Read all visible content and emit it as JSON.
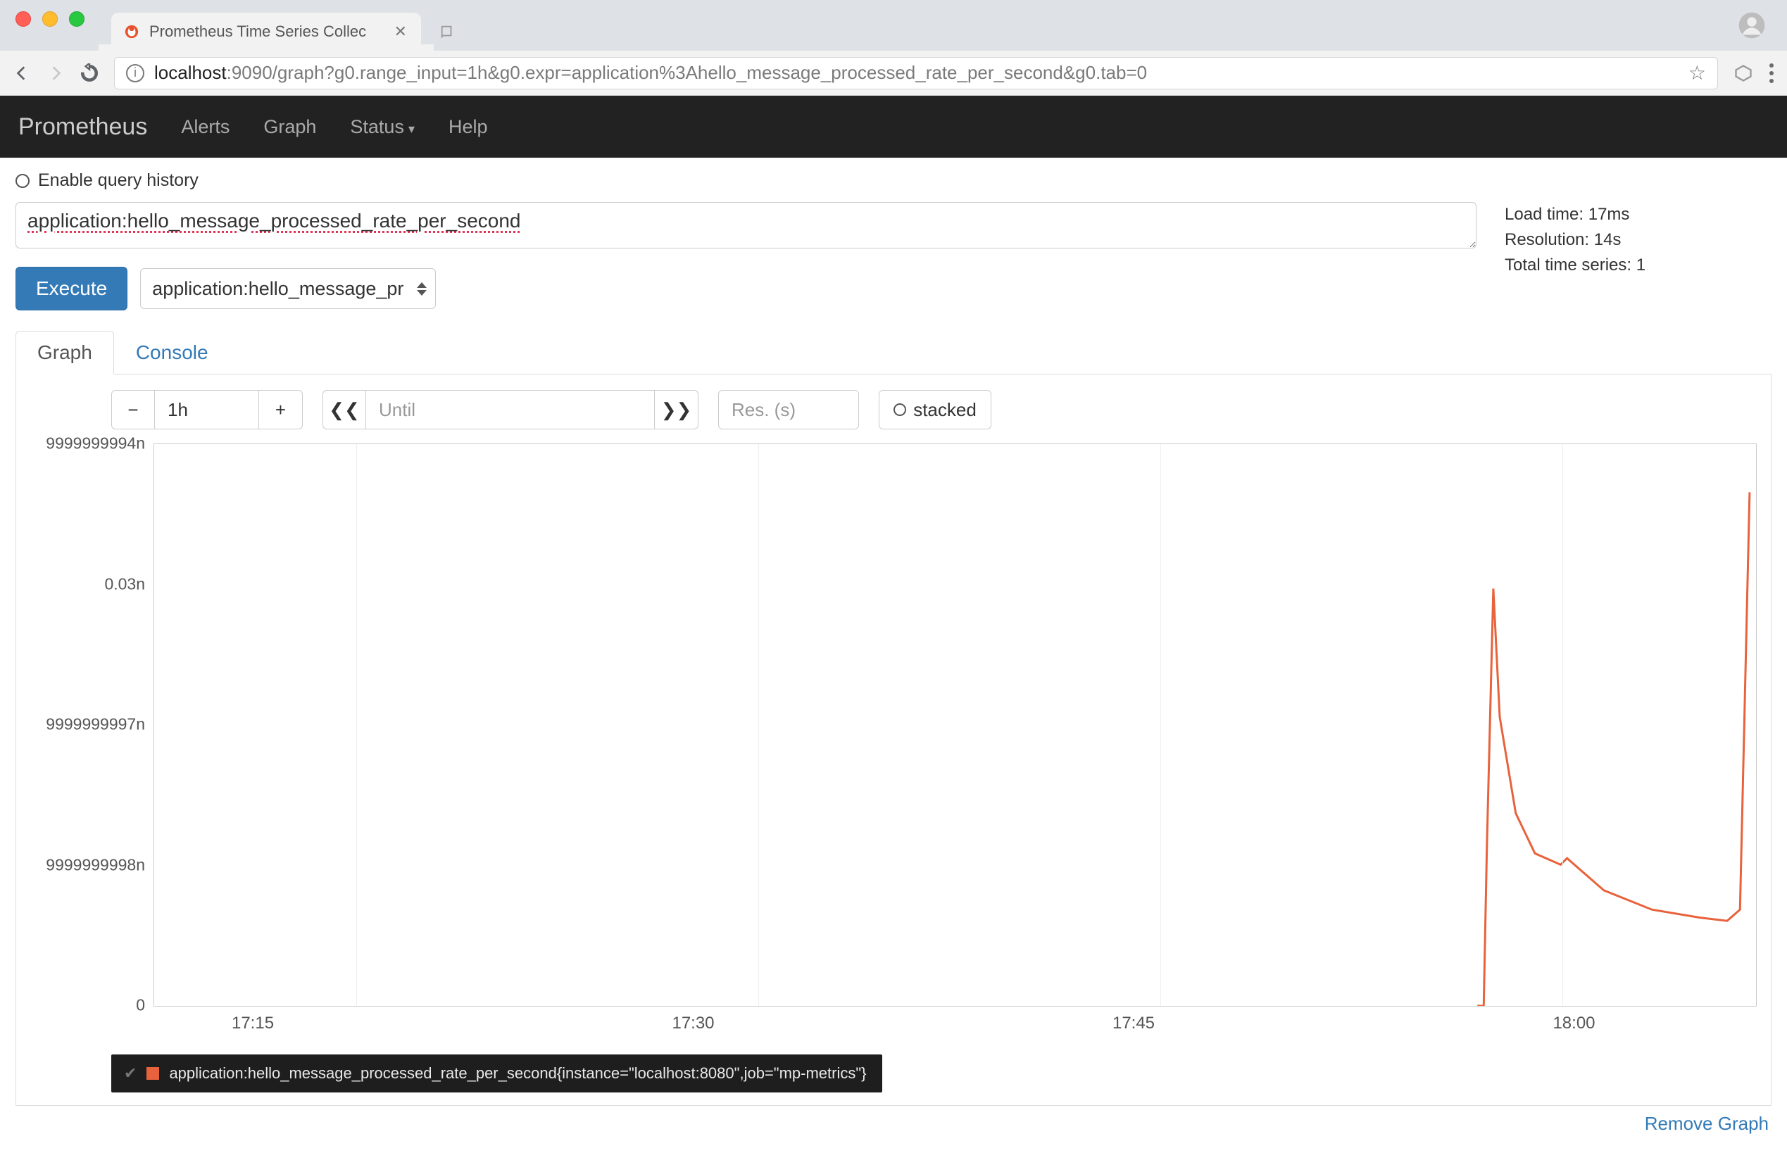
{
  "browser": {
    "tab_title": "Prometheus Time Series Collec",
    "url_prefix": "localhost",
    "url_rest": ":9090/graph?g0.range_input=1h&g0.expr=application%3Ahello_message_processed_rate_per_second&g0.tab=0"
  },
  "nav": {
    "brand": "Prometheus",
    "items": [
      "Alerts",
      "Graph",
      "Status",
      "Help"
    ],
    "status_has_caret": true
  },
  "query": {
    "history_label": "Enable query history",
    "expression": "application:hello_message_processed_rate_per_second",
    "execute_label": "Execute",
    "metric_dropdown": "application:hello_message_pr",
    "stats": {
      "load_time": "Load time: 17ms",
      "resolution": "Resolution: 14s",
      "total_series": "Total time series: 1"
    }
  },
  "tabs": {
    "graph": "Graph",
    "console": "Console",
    "active": "graph"
  },
  "controls": {
    "minus": "−",
    "range": "1h",
    "plus": "+",
    "prev": "❮❮",
    "until_placeholder": "Until",
    "next": "❯❯",
    "res_placeholder": "Res. (s)",
    "stacked_label": "stacked"
  },
  "chart_data": {
    "type": "line",
    "xlabel": "",
    "ylabel": "",
    "x_ticks": [
      "17:15",
      "17:30",
      "17:45",
      "18:00"
    ],
    "y_ticks": [
      "9999999994n",
      "0.03n",
      "9999999997n",
      "9999999998n",
      "0"
    ],
    "ylim_plot": [
      0,
      0.035
    ],
    "x_grid_positions_pct": [
      12.6,
      37.7,
      62.8,
      87.9
    ],
    "series": [
      {
        "name": "application:hello_message_processed_rate_per_second{instance=\"localhost:8080\",job=\"mp-metrics\"}",
        "color": "#e8623b",
        "points": [
          {
            "xr": 0.826,
            "y": 0.0
          },
          {
            "xr": 0.83,
            "y": 0.0
          },
          {
            "xr": 0.832,
            "y": 0.01
          },
          {
            "xr": 0.836,
            "y": 0.026
          },
          {
            "xr": 0.84,
            "y": 0.018
          },
          {
            "xr": 0.85,
            "y": 0.012
          },
          {
            "xr": 0.862,
            "y": 0.0095
          },
          {
            "xr": 0.878,
            "y": 0.0088
          },
          {
            "xr": 0.882,
            "y": 0.0092
          },
          {
            "xr": 0.905,
            "y": 0.0072
          },
          {
            "xr": 0.935,
            "y": 0.006
          },
          {
            "xr": 0.965,
            "y": 0.0055
          },
          {
            "xr": 0.982,
            "y": 0.0053
          },
          {
            "xr": 0.99,
            "y": 0.006
          },
          {
            "xr": 0.996,
            "y": 0.032
          }
        ]
      }
    ]
  },
  "legend": {
    "text": "application:hello_message_processed_rate_per_second{instance=\"localhost:8080\",job=\"mp-metrics\"}"
  },
  "remove_graph": "Remove Graph"
}
